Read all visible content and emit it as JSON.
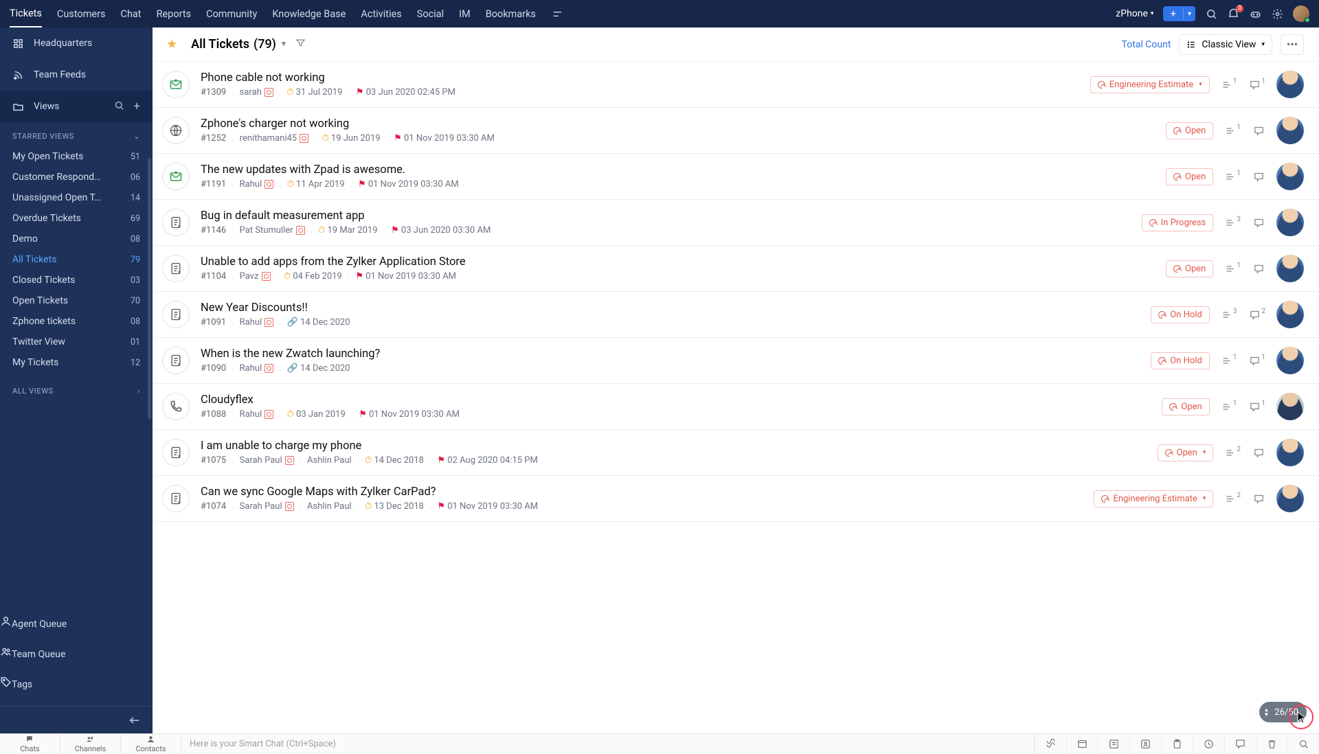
{
  "nav": {
    "tabs": [
      "Tickets",
      "Customers",
      "Chat",
      "Reports",
      "Community",
      "Knowledge Base",
      "Activities",
      "Social",
      "IM",
      "Bookmarks"
    ],
    "active": 0,
    "department": "zPhone",
    "notif_count": "3"
  },
  "sidebar": {
    "top": [
      {
        "label": "Headquarters",
        "icon": "grid"
      },
      {
        "label": "Team Feeds",
        "icon": "feed"
      },
      {
        "label": "Views",
        "icon": "folder",
        "tail": true
      }
    ],
    "starred_heading": "STARRED VIEWS",
    "starred": [
      {
        "name": "My Open Tickets",
        "count": "51"
      },
      {
        "name": "Customer Respond…",
        "count": "06"
      },
      {
        "name": "Unassigned Open T…",
        "count": "14"
      },
      {
        "name": "Overdue Tickets",
        "count": "69"
      },
      {
        "name": "Demo",
        "count": "08"
      },
      {
        "name": "All Tickets",
        "count": "79",
        "active": true
      },
      {
        "name": "Closed Tickets",
        "count": "03"
      },
      {
        "name": "Open Tickets",
        "count": "70"
      },
      {
        "name": "Zphone tickets",
        "count": "08"
      },
      {
        "name": "Twitter View",
        "count": "01"
      },
      {
        "name": "My Tickets",
        "count": "12"
      }
    ],
    "all_views": "ALL VIEWS",
    "bottom": [
      {
        "label": "Agent Queue",
        "icon": "agent"
      },
      {
        "label": "Team Queue",
        "icon": "team"
      },
      {
        "label": "Tags",
        "icon": "tag"
      }
    ]
  },
  "toolbar": {
    "title": "All Tickets",
    "count": "(79)",
    "total": "Total Count",
    "view": "Classic View"
  },
  "tickets": [
    {
      "channel": "mail",
      "subject": "Phone cable not working",
      "id": "#1309",
      "requester": "sarah",
      "created": "31 Jul 2019",
      "due": "03 Jun 2020 02:45 PM",
      "status": "Engineering Estimate",
      "status_caret": true,
      "threads": "1",
      "comments": "1",
      "owner": "a"
    },
    {
      "channel": "web",
      "subject": "Zphone's charger not working",
      "id": "#1252",
      "requester": "renithamani45",
      "created": "19 Jun 2019",
      "due": "01 Nov 2019 03:30 AM",
      "status": "Open",
      "threads": "1",
      "comments": "",
      "owner": "a"
    },
    {
      "channel": "mail",
      "subject": "The new updates with Zpad is awesome.",
      "id": "#1191",
      "requester": "Rahul",
      "created": "11 Apr 2019",
      "due": "01 Nov 2019 03:30 AM",
      "status": "Open",
      "threads": "1",
      "comments": "",
      "owner": "a"
    },
    {
      "channel": "form",
      "subject": "Bug in default measurement app",
      "id": "#1146",
      "requester": "Pat Stumuller",
      "created": "19 Mar 2019",
      "due": "03 Jun 2020 03:30 AM",
      "status": "In Progress",
      "threads": "3",
      "comments": "",
      "owner": "a"
    },
    {
      "channel": "form",
      "subject": "Unable to add apps from the Zylker Application Store",
      "id": "#1104",
      "requester": "Pavz",
      "created": "04 Feb 2019",
      "due": "01 Nov 2019 03:30 AM",
      "status": "Open",
      "threads": "1",
      "comments": "",
      "owner": "a"
    },
    {
      "channel": "form",
      "subject": "New Year Discounts!!",
      "id": "#1091",
      "requester": "Rahul",
      "created_share": "14 Dec 2020",
      "status": "On Hold",
      "threads": "3",
      "comments": "2",
      "owner": "a"
    },
    {
      "channel": "form",
      "subject": "When is the new Zwatch launching?",
      "id": "#1090",
      "requester": "Rahul",
      "created_share": "14 Dec 2020",
      "status": "On Hold",
      "threads": "1",
      "comments": "1",
      "owner": "a"
    },
    {
      "channel": "phone",
      "subject": "Cloudyflex",
      "id": "#1088",
      "requester": "Rahul",
      "created": "03 Jan 2019",
      "due": "01 Nov 2019 03:30 AM",
      "status": "Open",
      "threads": "1",
      "comments": "1",
      "owner": "b"
    },
    {
      "channel": "form",
      "subject": "I am unable to charge my phone",
      "id": "#1075",
      "requester": "Sarah Paul",
      "secondary": "Ashlin Paul",
      "created": "14 Dec 2018",
      "due": "02 Aug 2020 04:15 PM",
      "status": "Open",
      "status_caret": true,
      "threads": "2",
      "comments": "",
      "owner": "a"
    },
    {
      "channel": "form",
      "subject": "Can we sync Google Maps with Zylker CarPad?",
      "id": "#1074",
      "requester": "Sarah Paul",
      "secondary": "Ashlin Paul",
      "created": "13 Dec 2018",
      "due": "01 Nov 2019 03:30 AM",
      "status": "Engineering Estimate",
      "status_caret": true,
      "threads": "2",
      "comments": "",
      "owner": "a"
    }
  ],
  "pager": "26/50",
  "footer": {
    "tabs": [
      "Chats",
      "Channels",
      "Contacts"
    ],
    "smart": "Here is your Smart Chat (Ctrl+Space)"
  }
}
